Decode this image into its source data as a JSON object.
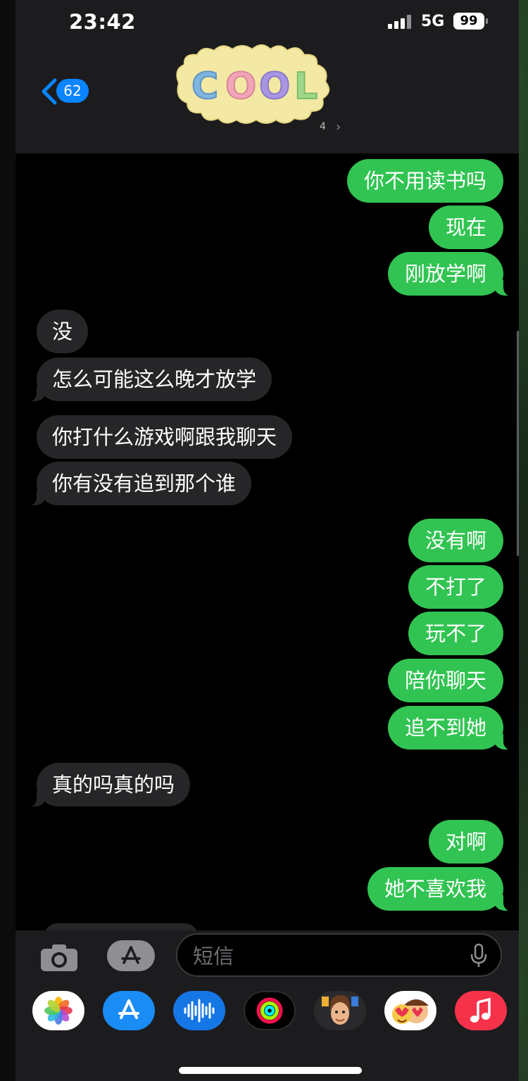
{
  "status": {
    "time": "23:42",
    "network": "5G",
    "battery": "99"
  },
  "header": {
    "back_badge": "62",
    "contact_name_partial": "4"
  },
  "sticker": {
    "text": "COOL"
  },
  "messages": [
    {
      "text": "你不用读书吗",
      "dir": "out"
    },
    {
      "text": "现在",
      "dir": "out"
    },
    {
      "text": "刚放学啊",
      "dir": "out"
    },
    {
      "text": "没",
      "dir": "in"
    },
    {
      "text": "怎么可能这么晚才放学",
      "dir": "in"
    },
    {
      "text": "你打什么游戏啊跟我聊天",
      "dir": "in"
    },
    {
      "text": "你有没有追到那个谁",
      "dir": "in"
    },
    {
      "text": "没有啊",
      "dir": "out"
    },
    {
      "text": "不打了",
      "dir": "out"
    },
    {
      "text": "玩不了",
      "dir": "out"
    },
    {
      "text": "陪你聊天",
      "dir": "out"
    },
    {
      "text": "追不到她",
      "dir": "out"
    },
    {
      "text": "真的吗真的吗",
      "dir": "in"
    },
    {
      "text": "对啊",
      "dir": "out"
    },
    {
      "text": "她不喜欢我",
      "dir": "out"
    }
  ],
  "compose": {
    "placeholder": "短信"
  },
  "drawer": {
    "apps": [
      {
        "name": "photos-icon"
      },
      {
        "name": "app-store-icon"
      },
      {
        "name": "audio-message-icon"
      },
      {
        "name": "activity-icon"
      },
      {
        "name": "memoji-icon"
      },
      {
        "name": "memoji-stickers-icon"
      },
      {
        "name": "music-icon"
      }
    ]
  },
  "colors": {
    "outgoing": "#31c452",
    "incoming": "#262628",
    "accent": "#0a84ff",
    "bar": "#1c1c1e"
  }
}
